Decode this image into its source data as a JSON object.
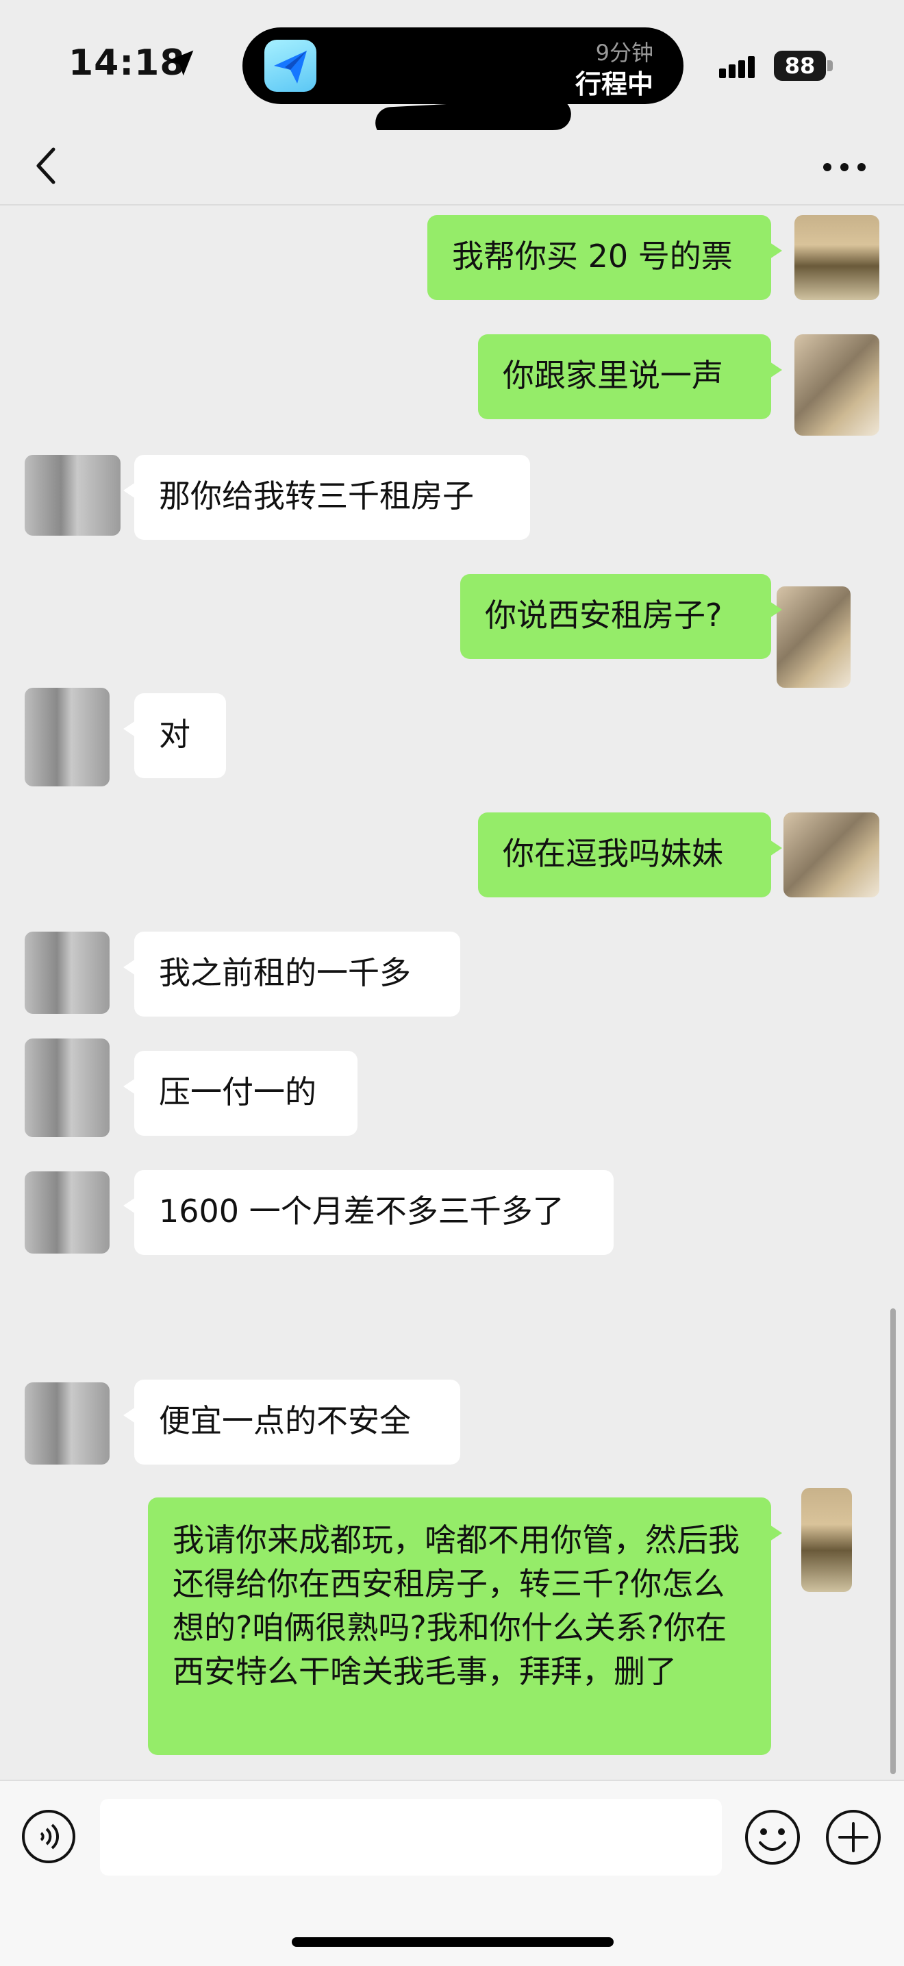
{
  "status_bar": {
    "time": "14:18",
    "island_duration": "9分钟",
    "island_status": "行程中",
    "battery": "88"
  },
  "messages": [
    {
      "side": "out",
      "text": "我帮你买 20 号的票"
    },
    {
      "side": "out",
      "text": "你跟家里说一声"
    },
    {
      "side": "in",
      "text": "那你给我转三千租房子"
    },
    {
      "side": "out",
      "text": "你说西安租房子?"
    },
    {
      "side": "in",
      "text": "对"
    },
    {
      "side": "out",
      "text": "你在逗我吗妹妹"
    },
    {
      "side": "in",
      "text": "我之前租的一千多"
    },
    {
      "side": "in",
      "text": "压一付一的"
    },
    {
      "side": "in",
      "text": "1600 一个月差不多三千多了"
    },
    {
      "side": "in",
      "text": "便宜一点的不安全"
    },
    {
      "side": "out",
      "text": "我请你来成都玩，啥都不用你管，然后我还得给你在西安租房子，转三千?你怎么想的?咱俩很熟吗?我和你什么关系?你在西安特么干啥关我毛事，拜拜，删了"
    }
  ],
  "input": {
    "value": ""
  },
  "colors": {
    "outgoing": "#95ec69",
    "incoming": "#ffffff",
    "background": "#ededed"
  },
  "icons": [
    "location-arrow-icon",
    "signal-icon",
    "back-icon",
    "more-icon",
    "voice-icon",
    "emoji-icon",
    "plus-icon"
  ]
}
